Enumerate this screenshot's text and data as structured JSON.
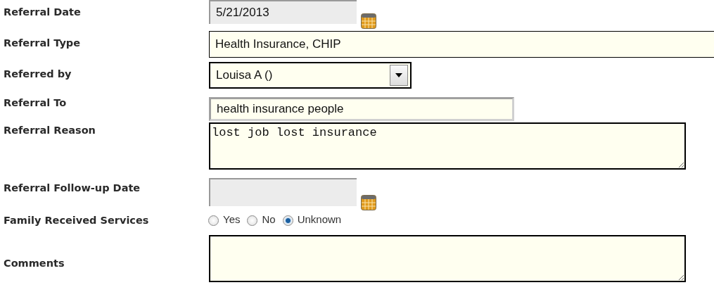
{
  "fields": [
    {
      "kind": "date",
      "label": "Referral Date",
      "value": "5/21/2013"
    },
    {
      "kind": "text-wide",
      "label": "Referral Type",
      "value": "Health Insurance, CHIP"
    },
    {
      "kind": "select",
      "label": "Referred by",
      "value": "Louisa A ()"
    },
    {
      "kind": "text",
      "label": "Referral To",
      "value": "health insurance people"
    },
    {
      "kind": "textarea",
      "label": "Referral Reason",
      "value": "lost job lost insurance"
    },
    {
      "kind": "date",
      "label": "Referral Follow-up Date"
    },
    {
      "kind": "radio",
      "label": "Family Received Services",
      "options": [
        {
          "label": "Yes",
          "selected": false
        },
        {
          "label": "No",
          "selected": false
        },
        {
          "label": "Unknown",
          "selected": true
        }
      ]
    },
    {
      "kind": "textarea",
      "label": "Comments"
    }
  ]
}
